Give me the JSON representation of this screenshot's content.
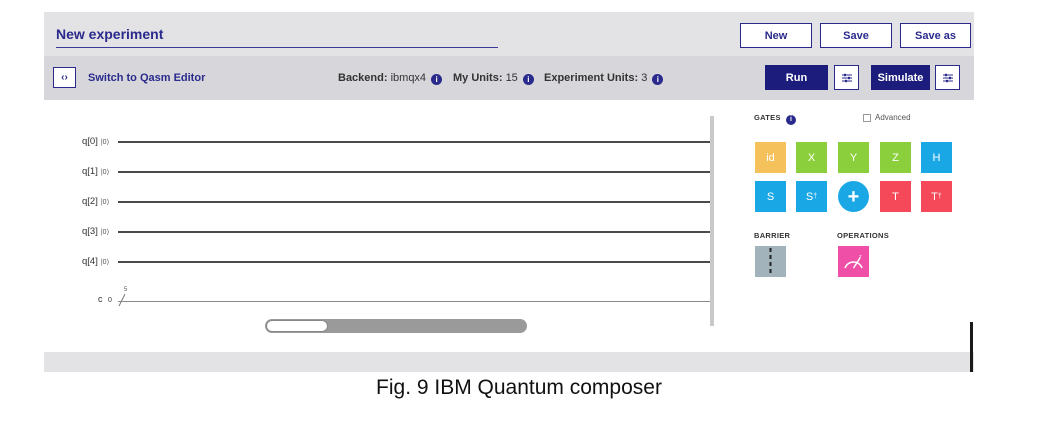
{
  "header": {
    "title": "New experiment",
    "buttons": {
      "new": "New",
      "save": "Save",
      "save_as": "Save as"
    }
  },
  "toolbar": {
    "toggle_icon": "‹›",
    "switch_label": "Switch to Qasm Editor",
    "backend_label": "Backend:",
    "backend_value": "ibmqx4",
    "my_units_label": "My Units:",
    "my_units_value": "15",
    "experiment_units_label": "Experiment Units:",
    "experiment_units_value": "3",
    "run": "Run",
    "simulate": "Simulate"
  },
  "circuit": {
    "qubits": [
      {
        "label": "q[0]",
        "ket": "|0⟩"
      },
      {
        "label": "q[1]",
        "ket": "|0⟩"
      },
      {
        "label": "q[2]",
        "ket": "|0⟩"
      },
      {
        "label": "q[3]",
        "ket": "|0⟩"
      },
      {
        "label": "q[4]",
        "ket": "|0⟩"
      }
    ],
    "classical": {
      "label": "c",
      "value": "0",
      "width": "5"
    }
  },
  "panel": {
    "gates_title": "GATES",
    "advanced": "Advanced",
    "barrier_title": "BARRIER",
    "operations_title": "OPERATIONS",
    "gates": {
      "id": "id",
      "x": "X",
      "y": "Y",
      "z": "Z",
      "h": "H",
      "s": "S",
      "sdg": "S",
      "t": "T",
      "tdg": "T",
      "dagger": "†",
      "plus": "+"
    },
    "colors": {
      "id": "#f5c15b",
      "pauli": "#8ccf3c",
      "h": "#1aa7e6",
      "s": "#1aa7e6",
      "cnot": "#1aa7e6",
      "t": "#f5495a",
      "barrier": "#a3b3bb",
      "measure": "#f04fa8"
    }
  },
  "caption": "Fig. 9 IBM Quantum composer"
}
